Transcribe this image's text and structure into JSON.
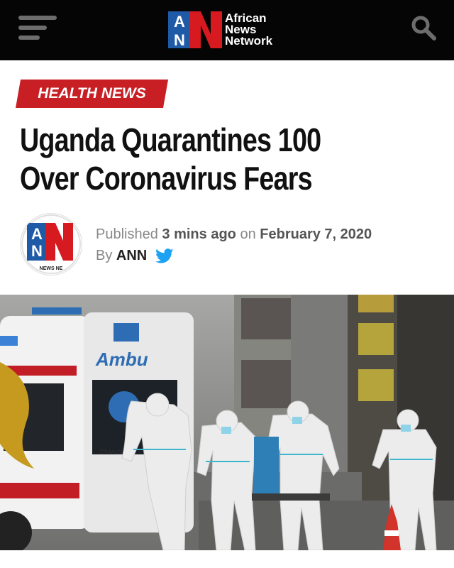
{
  "header": {
    "logo_letters": "AN",
    "logo_name_line1": "African",
    "logo_name_line2": "News",
    "logo_name_line3": "Network",
    "menu_icon": "hamburger-menu-icon",
    "search_icon": "search-icon"
  },
  "article": {
    "category": "HEALTH NEWS",
    "title_line1": "Uganda Quarantines 100",
    "title_line2": "Over Coronavirus Fears",
    "published_prefix": "Published",
    "published_relative": "3 mins ago",
    "published_on": "on",
    "published_date": "February 7, 2020",
    "by_prefix": "By",
    "author": "ANN",
    "avatar_text": "NEWS NE",
    "social_icon": "twitter-icon"
  },
  "photo": {
    "ambulance_text": "Ambu",
    "transit_text": "TRANSIT"
  },
  "colors": {
    "brand_red": "#c71f24",
    "brand_blue": "#1f5aa6",
    "twitter_blue": "#1da1f2"
  }
}
